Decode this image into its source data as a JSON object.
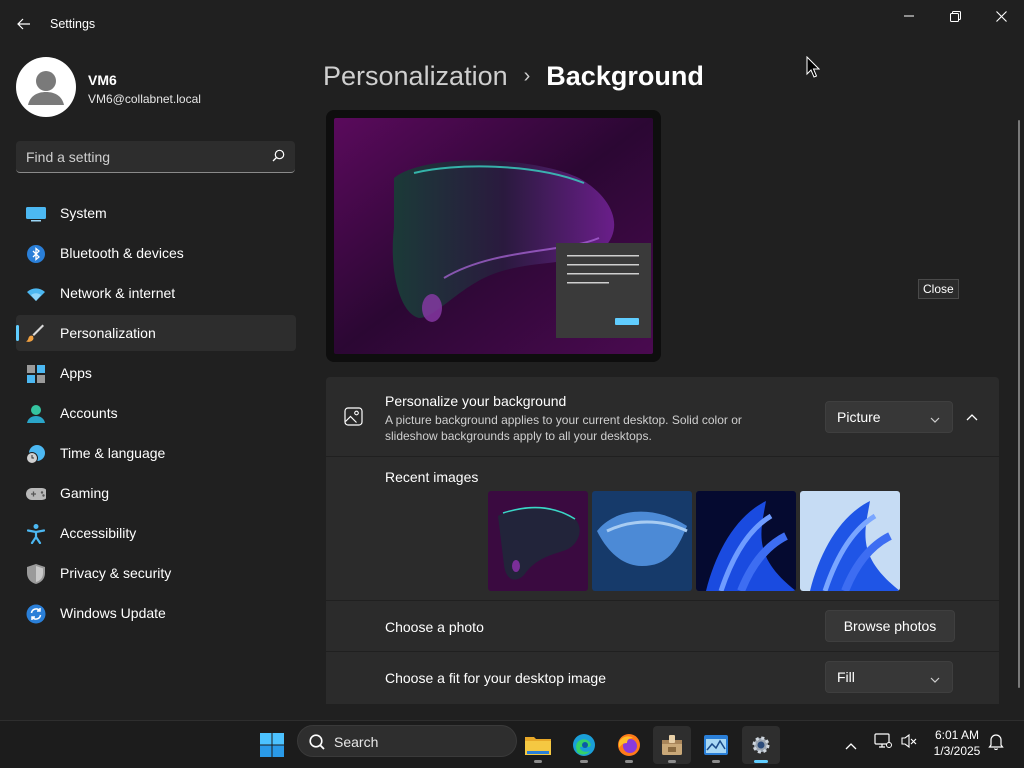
{
  "window": {
    "title": "Settings"
  },
  "profile": {
    "name": "VM6",
    "email": "VM6@collabnet.local"
  },
  "search": {
    "placeholder": "Find a setting"
  },
  "nav": {
    "items": [
      {
        "label": "System",
        "icon": "system-icon"
      },
      {
        "label": "Bluetooth & devices",
        "icon": "bluetooth-icon"
      },
      {
        "label": "Network & internet",
        "icon": "wifi-icon"
      },
      {
        "label": "Personalization",
        "icon": "brush-icon",
        "selected": true
      },
      {
        "label": "Apps",
        "icon": "apps-icon"
      },
      {
        "label": "Accounts",
        "icon": "accounts-icon"
      },
      {
        "label": "Time & language",
        "icon": "globe-clock-icon"
      },
      {
        "label": "Gaming",
        "icon": "gamepad-icon"
      },
      {
        "label": "Accessibility",
        "icon": "accessibility-icon"
      },
      {
        "label": "Privacy & security",
        "icon": "shield-icon"
      },
      {
        "label": "Windows Update",
        "icon": "update-icon"
      }
    ]
  },
  "breadcrumb": {
    "parent": "Personalization",
    "separator": "›",
    "current": "Background"
  },
  "background": {
    "title": "Personalize your background",
    "description": "A picture background applies to your current desktop. Solid color or slideshow backgrounds apply to all your desktops.",
    "type_value": "Picture"
  },
  "recent": {
    "label": "Recent images",
    "count": 4
  },
  "photo": {
    "label": "Choose a photo",
    "button": "Browse photos"
  },
  "fit": {
    "label": "Choose a fit for your desktop image",
    "value": "Fill"
  },
  "tooltip": {
    "text": "Close"
  },
  "taskbar": {
    "search_label": "Search"
  },
  "clock": {
    "time": "6:01 AM",
    "date": "1/3/2025"
  },
  "colors": {
    "accent": "#60cdff",
    "background": "#202020",
    "card": "#2b2b2b"
  }
}
